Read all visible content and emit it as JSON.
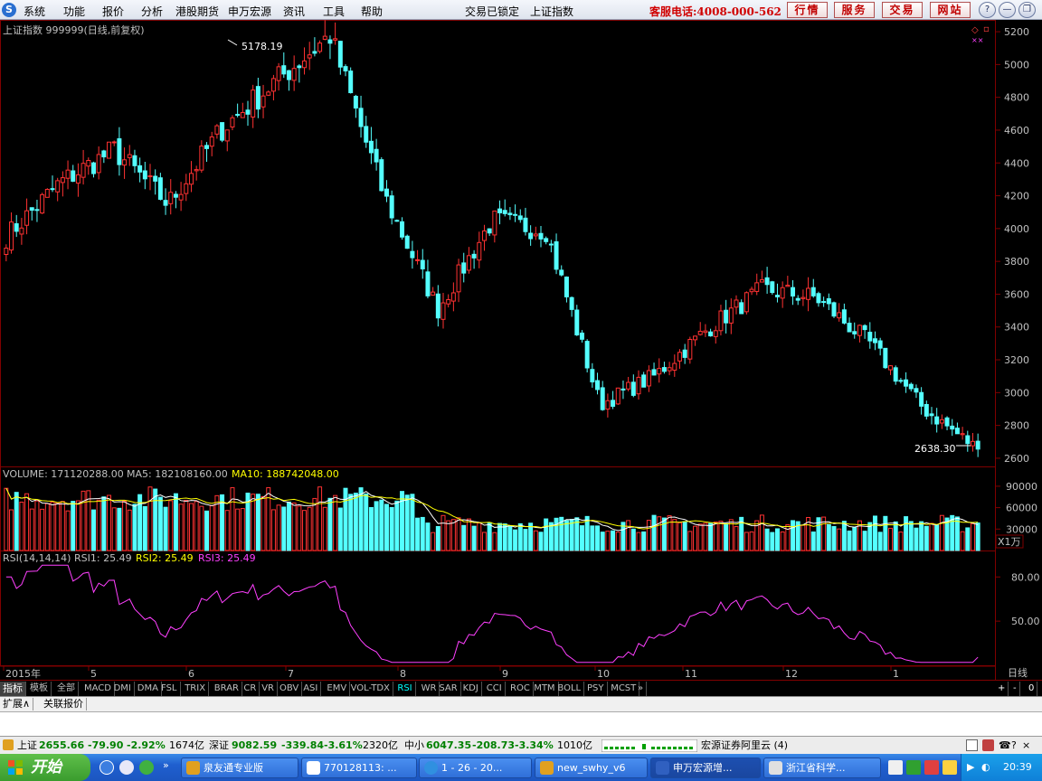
{
  "menubar": {
    "items": [
      "系统",
      "功能",
      "报价",
      "分析",
      "港股期货",
      "申万宏源",
      "资讯",
      "工具",
      "帮助"
    ],
    "lock_status": "交易已锁定",
    "current_index": "上证指数",
    "hotline": "客服电话:4008-000-562",
    "nav_buttons": [
      "行情",
      "服务",
      "交易",
      "网站"
    ],
    "win_buttons": [
      "?",
      "—",
      "❐",
      "✕"
    ]
  },
  "price_panel": {
    "header": "上证指数 999999(日线,前复权)",
    "y_ticks": [
      "5200",
      "5000",
      "4800",
      "4600",
      "4400",
      "4200",
      "4000",
      "3800",
      "3600",
      "3400",
      "3200",
      "3000",
      "2800",
      "2600"
    ],
    "high_label": "5178.19",
    "low_label": "2638.30"
  },
  "volume_panel": {
    "label": "VOLUME: 171120288.00",
    "ma5": "MA5: 182108160.00",
    "ma10": "MA10: 188742048.00",
    "y_ticks": [
      "90000",
      "60000",
      "30000"
    ],
    "unit": "X1万"
  },
  "rsi_panel": {
    "label": "RSI(14,14,14)",
    "rsi1": "RSI1: 25.49",
    "rsi2": "RSI2: 25.49",
    "rsi3": "RSI3: 25.49",
    "y_ticks": [
      "80.00",
      "50.00"
    ]
  },
  "x_axis": {
    "labels": [
      "2015年",
      "5",
      "6",
      "7",
      "8",
      "9",
      "10",
      "11",
      "12",
      "1"
    ],
    "period": "日线"
  },
  "chart_data": {
    "type": "candlestick",
    "title": "上证指数 999999(日线,前复权)",
    "period": "2015-04 to 2016-01",
    "ylim": [
      2550,
      5250
    ],
    "points": [
      {
        "x": "2015-04",
        "close": 3950
      },
      {
        "x": "2015-04-mid",
        "close": 4280
      },
      {
        "x": "2015-05-start",
        "close": 4480
      },
      {
        "x": "2015-05-mid",
        "close": 4150
      },
      {
        "x": "2015-05-late",
        "close": 4610
      },
      {
        "x": "2015-06-start",
        "close": 4900
      },
      {
        "x": "2015-06-12",
        "close": 5178.19
      },
      {
        "x": "2015-06-late",
        "close": 4200
      },
      {
        "x": "2015-07-08",
        "close": 3507
      },
      {
        "x": "2015-07-late",
        "close": 4050
      },
      {
        "x": "2015-08-mid",
        "close": 3990
      },
      {
        "x": "2015-08-26",
        "close": 2927
      },
      {
        "x": "2015-09",
        "close": 3100
      },
      {
        "x": "2015-10",
        "close": 3390
      },
      {
        "x": "2015-11",
        "close": 3630
      },
      {
        "x": "2015-12",
        "close": 3580
      },
      {
        "x": "2016-01-04",
        "close": 3300
      },
      {
        "x": "2016-01-mid",
        "close": 2900
      },
      {
        "x": "2016-01-end",
        "close": 2655.66
      }
    ],
    "low": 2638.3,
    "high": 5178.19,
    "volume_unit": "X1万",
    "volume_ylim": [
      0,
      100000
    ],
    "rsi": {
      "series": [
        "RSI1",
        "RSI2",
        "RSI3"
      ],
      "last": 25.49,
      "ylim": [
        20,
        90
      ]
    }
  },
  "tabs": [
    "指标",
    "模板",
    "全部",
    "MACD",
    "DMI",
    "DMA",
    "FSL",
    "TRIX",
    "BRAR",
    "CR",
    "VR",
    "OBV",
    "ASI",
    "EMV",
    "VOL-TDX",
    "RSI",
    "WR",
    "SAR",
    "KDJ",
    "CCI",
    "ROC",
    "MTM",
    "BOLL",
    "PSY",
    "MCST"
  ],
  "tab_more": "»",
  "tab_right": [
    "+",
    "-",
    "0"
  ],
  "subtabs": [
    "扩展∧",
    "关联报价"
  ],
  "status": {
    "sh_label": "上证",
    "sh_value": "2655.66",
    "sh_change": "-79.90",
    "sh_pct": "-2.92%",
    "sh_amount": "1674亿",
    "sz_label": "深证",
    "sz_value": "9082.59",
    "sz_change": "-339.84",
    "sz_pct": "-3.61%",
    "sz_amount": "2320亿",
    "zx_label": "中小",
    "zx_value": "6047.35",
    "zx_change": "-208.73",
    "zx_pct": "-3.34%",
    "zx_amount": "1010亿",
    "server": "宏源证券阿里云 (4)"
  },
  "taskbar": {
    "start": "开始",
    "tasks": [
      "泉友通专业版",
      "770128113: ...",
      "1 - 26 - 20...",
      "new_swhy_v6",
      "申万宏源增...",
      "浙江省科学..."
    ],
    "clock": "20:39"
  }
}
